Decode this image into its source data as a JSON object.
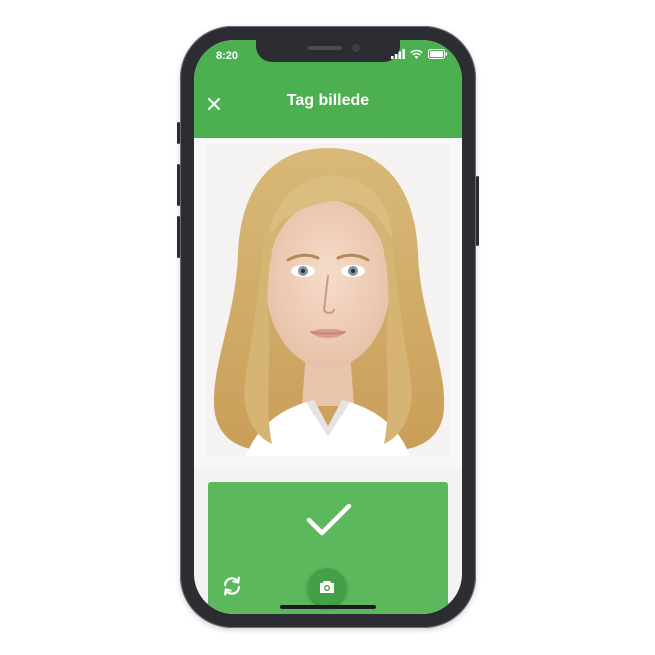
{
  "status_bar": {
    "time": "8:20",
    "icons": [
      "signal-icon",
      "wifi-icon",
      "battery-icon"
    ]
  },
  "header": {
    "title": "Tag billede",
    "close_icon": "close-icon"
  },
  "photo": {
    "description_icon": "portrait-photo"
  },
  "actions": {
    "confirm_icon": "checkmark-icon",
    "switch_camera_icon": "switch-camera-icon",
    "capture_icon": "camera-icon"
  },
  "colors": {
    "primary": "#4caf50",
    "panel": "#5cb85c",
    "capture_button": "#43a047"
  }
}
